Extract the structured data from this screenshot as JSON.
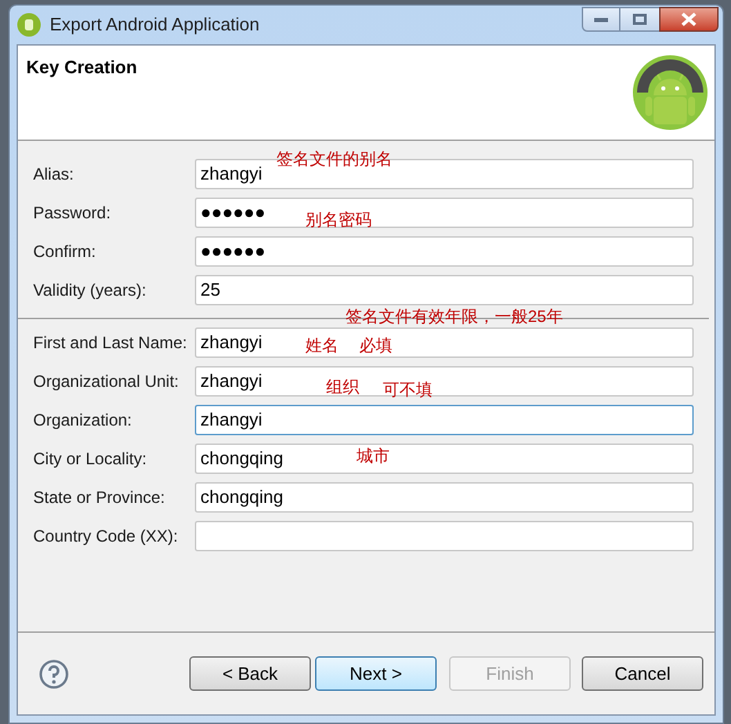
{
  "window": {
    "title": "Export Android Application"
  },
  "banner": {
    "title": "Key Creation"
  },
  "field_groups": [
    [
      {
        "label": "Alias:",
        "value": "zhangyi",
        "focused": false
      },
      {
        "label": "Password:",
        "value": "●●●●●●",
        "focused": false
      },
      {
        "label": "Confirm:",
        "value": "●●●●●●",
        "focused": false
      },
      {
        "label": "Validity (years):",
        "value": "25",
        "focused": false
      }
    ],
    [
      {
        "label": "First and Last Name:",
        "value": "zhangyi",
        "focused": false
      },
      {
        "label": "Organizational Unit:",
        "value": "zhangyi",
        "focused": false
      },
      {
        "label": "Organization:",
        "value": "zhangyi",
        "focused": true
      },
      {
        "label": "City or Locality:",
        "value": "chongqing",
        "focused": false
      },
      {
        "label": "State or Province:",
        "value": "chongqing",
        "focused": false
      },
      {
        "label": "Country Code (XX):",
        "focused": false
      }
    ]
  ],
  "annotations": [
    {
      "text": "签名文件的别名"
    },
    {
      "text": "别名密码"
    },
    {
      "text": "签名文件有效年限，一般25年"
    },
    {
      "text": "姓名"
    },
    {
      "text": "必填"
    },
    {
      "text": "组织"
    },
    {
      "text": "可不填"
    },
    {
      "text": "城市"
    }
  ],
  "buttons": [
    {
      "label": "< Back",
      "kind": "normal",
      "disabled": false
    },
    {
      "label": "Next >",
      "kind": "default",
      "disabled": false
    },
    {
      "label": "Finish",
      "kind": "normal",
      "disabled": true
    },
    {
      "label": "Cancel",
      "kind": "normal",
      "disabled": false
    }
  ]
}
